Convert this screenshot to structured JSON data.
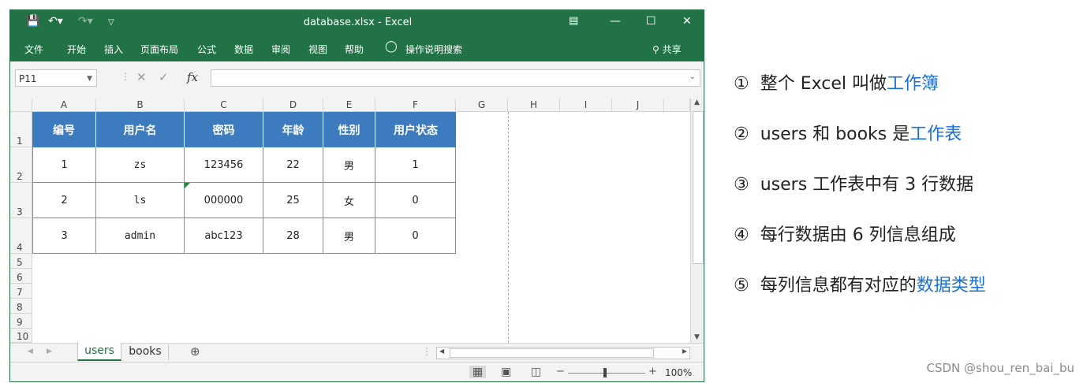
{
  "window": {
    "title": "database.xlsx  -  Excel",
    "share_label": "共享",
    "colors": {
      "titlebar": "#217346",
      "header_fill": "#3d7bbf",
      "highlight_text": "#1a6fd8"
    }
  },
  "ribbon": {
    "tabs": [
      "文件",
      "开始",
      "插入",
      "页面布局",
      "公式",
      "数据",
      "审阅",
      "视图",
      "帮助"
    ],
    "search_label": "操作说明搜索"
  },
  "formula_bar": {
    "name_box": "P11",
    "fx_label": "fx",
    "formula": ""
  },
  "sheet": {
    "columns": [
      "A",
      "B",
      "C",
      "D",
      "E",
      "F",
      "G",
      "H",
      "I",
      "J"
    ],
    "rows": [
      "1",
      "2",
      "3",
      "4",
      "5",
      "6",
      "7",
      "8",
      "9",
      "10"
    ],
    "headers": [
      "编号",
      "用户名",
      "密码",
      "年龄",
      "性别",
      "用户状态"
    ],
    "data": [
      [
        "1",
        "zs",
        "123456",
        "22",
        "男",
        "1"
      ],
      [
        "2",
        "ls",
        "000000",
        "25",
        "女",
        "0"
      ],
      [
        "3",
        "admin",
        "abc123",
        "28",
        "男",
        "0"
      ]
    ]
  },
  "sheet_tabs": {
    "tabs": [
      "users",
      "books"
    ],
    "active": "users"
  },
  "status": {
    "zoom": "100%"
  },
  "notes": [
    {
      "n": "①",
      "pre": "整个 Excel 叫做",
      "hl": "工作簿"
    },
    {
      "n": "②",
      "pre": "users 和 books 是",
      "hl": "工作表"
    },
    {
      "n": "③",
      "pre": "users 工作表中有 3 行数据",
      "hl": ""
    },
    {
      "n": "④",
      "pre": "每行数据由 6 列信息组成",
      "hl": ""
    },
    {
      "n": "⑤",
      "pre": "每列信息都有对应的",
      "hl": "数据类型"
    }
  ],
  "watermark": "CSDN @shou_ren_bai_bu"
}
